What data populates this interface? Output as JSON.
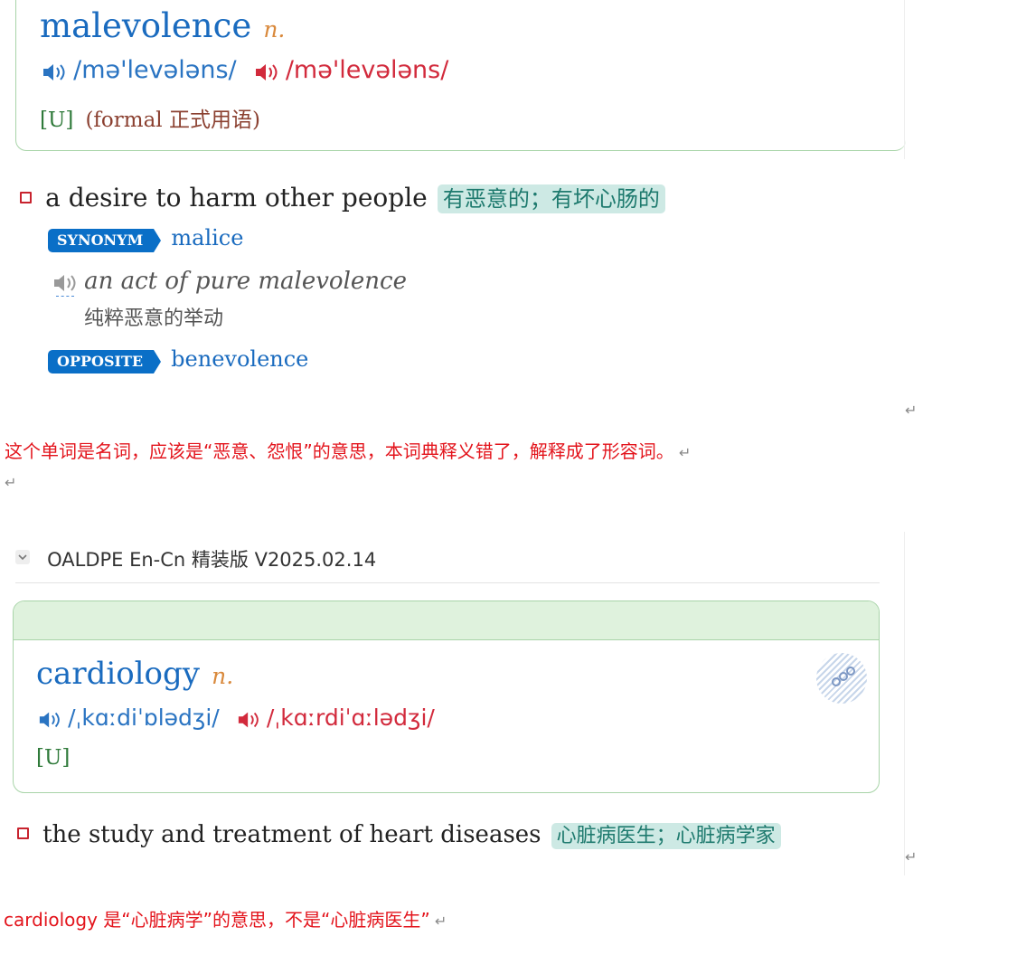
{
  "entry1": {
    "headword": "malevolence",
    "pos": "n.",
    "pron_uk": "/mə'levələns/",
    "pron_us": "/mə'levələns/",
    "grammar": "[U]",
    "label": "(formal 正式用语)",
    "definition": "a desire to harm other people",
    "definition_cn": "有恶意的；有坏心肠的",
    "synonym_badge": "SYNONYM",
    "synonym": "malice",
    "example": "an act of pure malevolence",
    "example_cn": "纯粹恶意的举动",
    "opposite_badge": "OPPOSITE",
    "opposite": "benevolence"
  },
  "note1": "这个单词是名词，应该是“恶意、怨恨”的意思，本词典释义错了，解释成了形容词。",
  "return_mark": "↵",
  "source": {
    "chevron": "⌄",
    "title": "OALDPE En-Cn 精装版 V2025.02.14"
  },
  "entry2": {
    "headword": "cardiology",
    "pos": "n.",
    "pron_uk": "/ˌkɑːdiˈɒlədʒi/",
    "pron_us": "/ˌkɑːrdiˈɑːlədʒi/",
    "grammar": "[U]",
    "definition": "the study and treatment of heart diseases",
    "definition_cn": "心脏病医生；心脏病学家"
  },
  "note2": "cardiology 是“心脏病学”的意思，不是“心脏病医生”",
  "colors": {
    "headword": "#1a6bbf",
    "pos": "#d9893c",
    "pron_uk": "#2a74c2",
    "pron_us": "#d22a3c",
    "note": "#e3141c",
    "badge": "#0a6fc7",
    "highlight_bg": "#cde9e4"
  },
  "icons": [
    "speaker-icon",
    "checkbox-icon",
    "chevron-down-icon",
    "stamp-icon",
    "return-mark-icon"
  ]
}
